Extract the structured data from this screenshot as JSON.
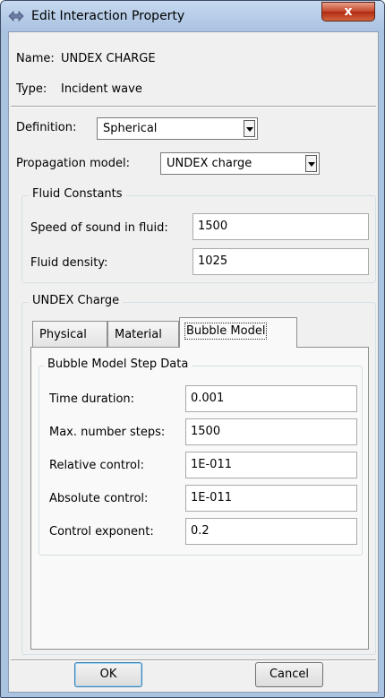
{
  "window": {
    "title": "Edit Interaction Property",
    "close_glyph": "x"
  },
  "info": {
    "name_label": "Name:",
    "name_value": "UNDEX CHARGE",
    "type_label": "Type:",
    "type_value": "Incident wave"
  },
  "definition": {
    "label": "Definition:",
    "value": "Spherical"
  },
  "propagation": {
    "label": "Propagation model:",
    "value": "UNDEX charge"
  },
  "fluid_constants": {
    "title": "Fluid Constants",
    "speed_label": "Speed of sound in fluid:",
    "speed_value": "1500",
    "density_label": "Fluid density:",
    "density_value": "1025"
  },
  "undex_charge": {
    "title": "UNDEX Charge",
    "tabs": [
      {
        "label": "Physical"
      },
      {
        "label": "Material"
      },
      {
        "label": "Bubble Model",
        "active": true
      }
    ],
    "step_data": {
      "title": "Bubble Model Step Data",
      "rows": [
        {
          "label": "Time duration:",
          "value": "0.001"
        },
        {
          "label": "Max. number steps:",
          "value": "1500"
        },
        {
          "label": "Relative control:",
          "value": "1E-011"
        },
        {
          "label": "Absolute control:",
          "value": "1E-011"
        },
        {
          "label": "Control exponent:",
          "value": "0.2"
        }
      ]
    }
  },
  "buttons": {
    "ok": "OK",
    "cancel": "Cancel"
  },
  "icons": {
    "title_icon": "double-arrow-icon",
    "dropdown_icon": "chevron-down-icon"
  }
}
